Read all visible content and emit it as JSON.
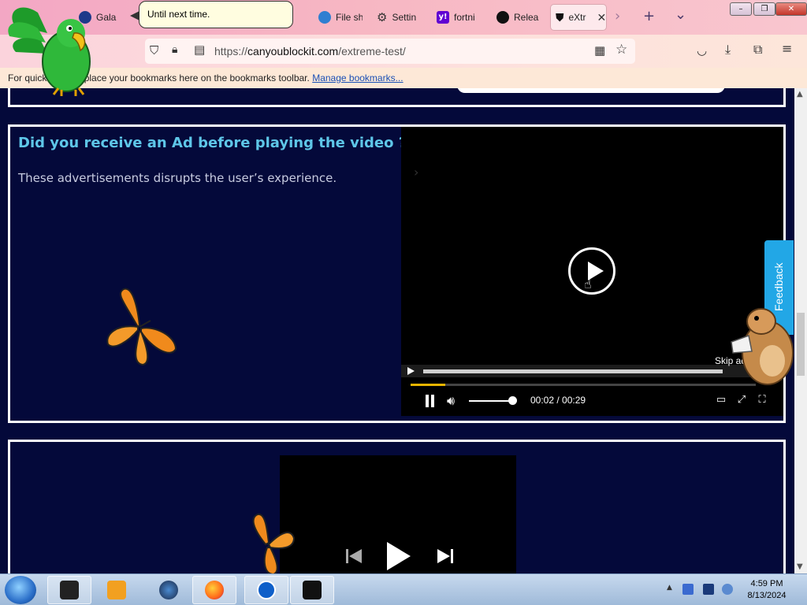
{
  "browser": {
    "tabs": [
      {
        "label": "Gala",
        "icon": "galaxy-icon",
        "color": "#1e3a8a"
      },
      {
        "label": "File sh",
        "icon": "share-icon",
        "color": "#2f7fd1"
      },
      {
        "label": "Settin",
        "icon": "gear-icon",
        "color": "#333333"
      },
      {
        "label": "fortni",
        "icon": "yahoo-icon",
        "color": "#6001d2"
      },
      {
        "label": "Relea",
        "icon": "github-icon",
        "color": "#111111"
      },
      {
        "label": "eXtr",
        "icon": "shield-icon",
        "color": "#111111",
        "active": true
      }
    ],
    "new_tab": "+",
    "list_tabs": "⌄",
    "url_scheme": "https://",
    "url_host": "canyoublockit.com",
    "url_path": "/extreme-test/",
    "window_buttons": {
      "minimize": "–",
      "restore": "❐",
      "close": "✕"
    }
  },
  "bookmarks": {
    "text": "For quick access, place your bookmarks here on the bookmarks toolbar.",
    "link": "Manage bookmarks..."
  },
  "bubble": {
    "text": "Until next time."
  },
  "section2": {
    "title": "Did you receive an Ad before playing the video ?",
    "desc": "These advertisements disrupts the user’s experience.",
    "video": {
      "skip_label": "Skip ad",
      "time": "00:02 / 00:29",
      "progress": 0.1,
      "volume": 1.0
    }
  },
  "feedback": {
    "label": "Feedback"
  },
  "taskbar": {
    "time": "4:59 PM",
    "date": "8/13/2024"
  },
  "colors": {
    "page_bg": "#04093a",
    "title": "#5ec6e8",
    "feedback": "#22a7e6"
  }
}
